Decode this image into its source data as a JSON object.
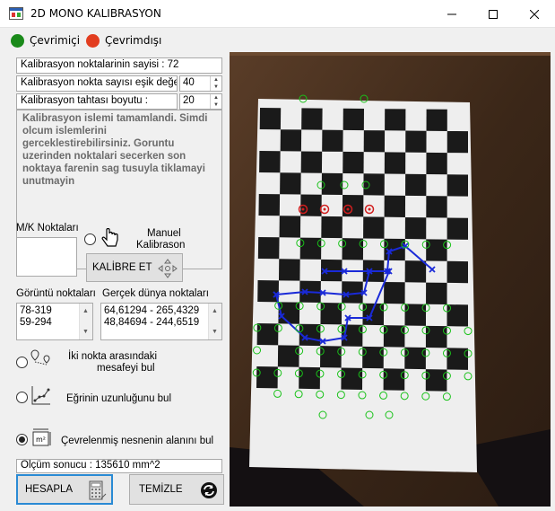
{
  "window": {
    "title": "2D MONO KALIBRASYON",
    "icon": "app-window-icon",
    "controls": {
      "minimize": "minimize-icon",
      "maximize": "maximize-icon",
      "close": "close-icon"
    }
  },
  "status": {
    "online_label": "Çevrimiçi",
    "online_color": "#1a8a1a",
    "offline_label": "Çevrimdışı",
    "offline_color": "#e23d1f"
  },
  "calibration": {
    "points_count_text": "Kalibrasyon noktalarinin sayisi : 72",
    "threshold_label": "Kalibrasyon nokta sayısı eşik değeri :",
    "threshold_value": "40",
    "board_size_label": "Kalibrasyon tahtası boyutu :",
    "board_size_value": "20",
    "message": "Kalibrasyon islemi tamamlandi. Simdi olcum islemlerini gerceklestirebilirsiniz. Goruntu uzerinden noktalari secerken son noktaya farenin sag tusuyla tiklamayi unutmayin"
  },
  "mk": {
    "label": "M/K Noktaları",
    "manual_label_1": "Manuel",
    "manual_label_2": "Kalibrason",
    "cursor_icon": "hand-pointer-icon",
    "calibrate_button": "KALİBRE ET",
    "calibrate_icon": "move-arrows-icon"
  },
  "points": {
    "image_label": "Görüntü noktaları",
    "image_points": [
      "78-319",
      "59-294"
    ],
    "world_label": "Gerçek dünya noktaları",
    "world_points": [
      "64,61294 - 265,4329",
      "48,84694 - 244,6519"
    ]
  },
  "measure": {
    "distance_label_1": "İki nokta arasındaki",
    "distance_label_2": "mesafeyi bul",
    "distance_icon": "two-pins-icon",
    "curve_label": "Eğrinin uzunluğunu bul",
    "curve_icon": "curve-chart-icon",
    "area_label": "Çevrelenmiş nesnenin alanını bul",
    "area_icon": "area-m2-icon",
    "selected": "area",
    "result_text": "Ölçüm sonucu : 135610 mm^2"
  },
  "actions": {
    "compute_button": "HESAPLA",
    "compute_icon": "calculator-icon",
    "clear_button": "TEMİZLE",
    "clear_icon": "refresh-icon"
  },
  "image_view": {
    "description_icon": "checkerboard-photo",
    "green_marker_color": "#19c219",
    "red_marker_color": "#d11f1f",
    "blue_line_color": "#1a2ad8"
  }
}
